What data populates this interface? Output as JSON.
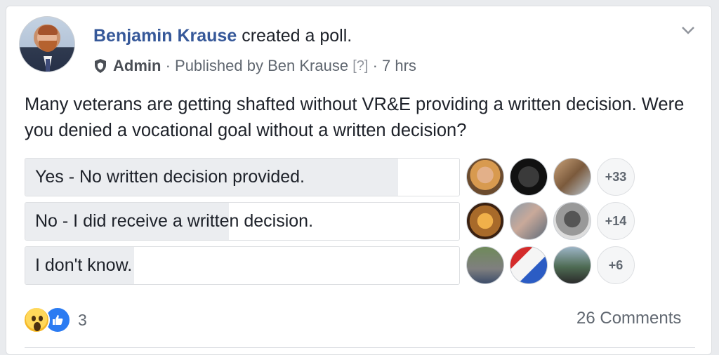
{
  "post": {
    "author": "Benjamin Krause",
    "action": " created a poll.",
    "role": "Admin",
    "published_by": "Published by Ben Krause",
    "help": "[?]",
    "time": "7 hrs",
    "text": "Many veterans are getting shafted without VR&E providing a written decision. Were you denied a vocational goal without a written decision?"
  },
  "poll": {
    "options": [
      {
        "label": "Yes - No written decision provided.",
        "fill": 0.86,
        "more": "+33"
      },
      {
        "label": "No - I did receive a written decision.",
        "fill": 0.47,
        "more": "+14"
      },
      {
        "label": "I don't know.",
        "fill": 0.25,
        "more": "+6"
      }
    ]
  },
  "footer": {
    "reaction_count": "3",
    "comments": "26 Comments"
  },
  "icons": {
    "reactions": [
      "wow-icon",
      "like-icon"
    ],
    "admin": "shield-icon",
    "menu": "chevron-down-icon"
  },
  "colors": {
    "author": "#365899",
    "poll_fill": "#ebedf0",
    "like": "#2b7bf2"
  }
}
